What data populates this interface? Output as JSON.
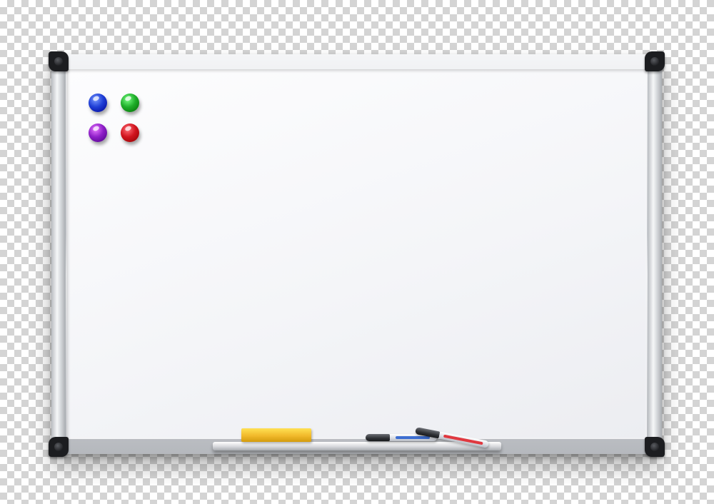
{
  "scene": {
    "background": "transparency-checkerboard",
    "checker_colors": [
      "#ffffff",
      "#d4d4d4"
    ]
  },
  "whiteboard": {
    "frame_color": "#d7d9dc",
    "surface_color": "#f4f5f8",
    "corner_color": "#1c1d20",
    "magnets": [
      {
        "name": "magnet-blue",
        "color": "#1f3fd6"
      },
      {
        "name": "magnet-green",
        "color": "#1fae2a"
      },
      {
        "name": "magnet-purple",
        "color": "#8e1fc8"
      },
      {
        "name": "magnet-red",
        "color": "#d1141e"
      }
    ],
    "accessories": {
      "eraser_color": "#f1b92b",
      "markers": [
        {
          "name": "marker-blue",
          "color": "#3d6ed1"
        },
        {
          "name": "marker-red",
          "color": "#e0383f"
        }
      ]
    }
  }
}
